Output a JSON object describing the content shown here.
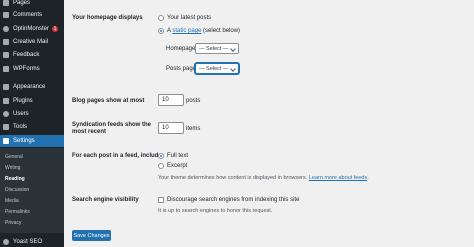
{
  "sidebar": {
    "items": [
      {
        "label": "Pages",
        "icon": "pages-icon"
      },
      {
        "label": "Comments",
        "icon": "comments-icon"
      },
      {
        "label": "OptinMonster",
        "icon": "optinmonster-icon",
        "badge": "1"
      },
      {
        "label": "Creative Mail",
        "icon": "creative-mail-icon"
      },
      {
        "label": "Feedback",
        "icon": "feedback-icon"
      },
      {
        "label": "WPForms",
        "icon": "wpforms-icon"
      },
      {
        "label": "Appearance",
        "icon": "appearance-icon"
      },
      {
        "label": "Plugins",
        "icon": "plugins-icon"
      },
      {
        "label": "Users",
        "icon": "users-icon"
      },
      {
        "label": "Tools",
        "icon": "tools-icon"
      },
      {
        "label": "Settings",
        "icon": "settings-icon"
      }
    ],
    "submenu": [
      "General",
      "Writing",
      "Reading",
      "Discussion",
      "Media",
      "Permalinks",
      "Privacy"
    ],
    "bottom_item": {
      "label": "Yoast SEO",
      "icon": "yoast-icon"
    }
  },
  "homepage": {
    "label": "Your homepage displays",
    "option_latest": "Your latest posts",
    "option_static_prefix": "A ",
    "option_static_link": "static page",
    "option_static_suffix": " (select below)",
    "homepage_label": "Homepage:",
    "homepage_value": "— Select —",
    "posts_label": "Posts page:",
    "posts_value": "— Select —"
  },
  "blog_pages": {
    "label": "Blog pages show at most",
    "value": "10",
    "unit": "posts"
  },
  "syndication": {
    "label_line1": "Syndication feeds show the",
    "label_line2": "most recent",
    "value": "10",
    "unit": "items"
  },
  "feed": {
    "label": "For each post in a feed, include",
    "option_full": "Full text",
    "option_excerpt": "Excerpt",
    "desc_prefix": "Your theme determines how content is displayed in browsers. ",
    "desc_link": "Learn more about feeds"
  },
  "search": {
    "label": "Search engine visibility",
    "checkbox_label": "Discourage search engines from indexing this site",
    "desc": "It is up to search engines to honor this request."
  },
  "save_button": "Save Changes",
  "colors": {
    "sidebar": "#1d2327",
    "submenu": "#2c3338",
    "accent": "#2271b1",
    "badge": "#d63638"
  }
}
